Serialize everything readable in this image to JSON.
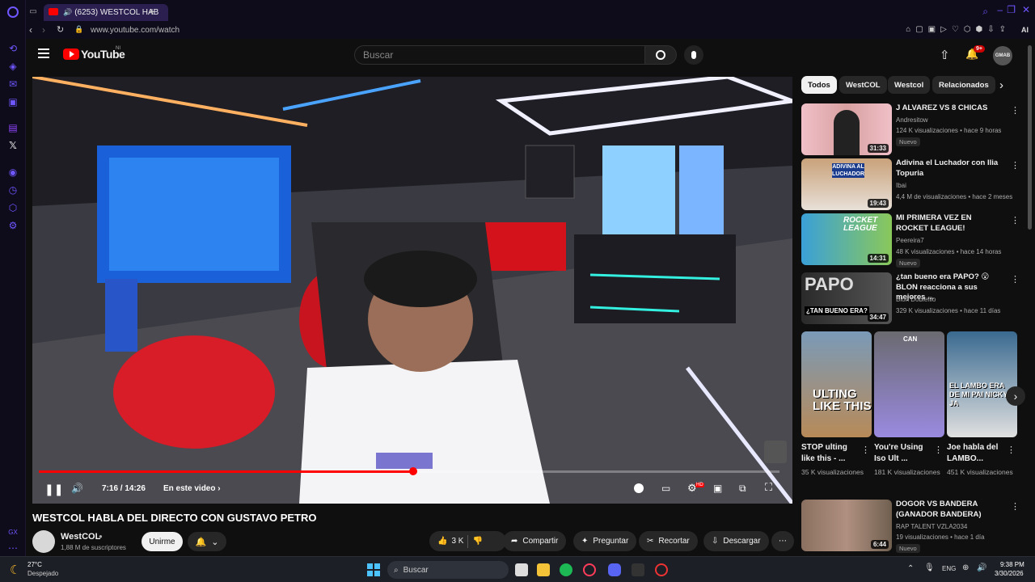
{
  "browser": {
    "tab_title": "(6253) WESTCOL HAB",
    "new_tab": "+",
    "url": "www.youtube.com/watch",
    "ai_label": "AI"
  },
  "youtube": {
    "logo_text": "YouTube",
    "logo_country": "NI",
    "search_placeholder": "Buscar",
    "notif_count": "9+",
    "avatar_text": "GMAB"
  },
  "player": {
    "time": "7:16 / 14:26",
    "chapter": "En este video",
    "chapter_arrow": "›",
    "progress": 0.505,
    "hd_badge": "HD"
  },
  "video": {
    "title": "WESTCOL HABLA DEL DIRECTO CON GUSTAVO PETRO",
    "channel": "WestCOL",
    "subscribers": "1,88 M de suscriptores",
    "join": "Unirme",
    "likes": "3 K",
    "share": "Compartir",
    "ask": "Preguntar",
    "clip": "Recortar",
    "download": "Descargar"
  },
  "chips": [
    "Todos",
    "WestCOL",
    "Westcol",
    "Relacionados"
  ],
  "related": [
    {
      "title": "J ALVAREZ VS 8 CHICAS",
      "channel": "Andresitow",
      "meta": "124 K visualizaciones • hace 9 horas",
      "duration": "31:33",
      "badge": "Nuevo"
    },
    {
      "title": "Adivina el Luchador con Ilia Topuria",
      "channel": "Ibai",
      "meta": "4,4 M de visualizaciones • hace 2 meses",
      "duration": "19:43",
      "badge": ""
    },
    {
      "title": "MI PRIMERA VEZ EN ROCKET LEAGUE!",
      "channel": "Peereira7",
      "meta": "48 K visualizaciones • hace 14 horas",
      "duration": "14:31",
      "badge": "Nuevo"
    },
    {
      "title": "¿tan bueno era PAPO? 😮 BLON reacciona a sus mejores ...",
      "channel": "Blon Doblefilo",
      "meta": "329 K visualizaciones • hace 11 días",
      "duration": "34:47",
      "badge": ""
    }
  ],
  "shorts": [
    {
      "title": "STOP ulting like this - ...",
      "views": "35 K visualizaciones",
      "overlay": "ULTING LIKE THIS"
    },
    {
      "title": "You're Using Iso Ult ...",
      "views": "181 K visualizaciones",
      "overlay": "CAN"
    },
    {
      "title": "Joe habla del LAMBO...",
      "views": "451 K visualizaciones",
      "overlay": "EL LAMBO ERA DE MI PAI NICKY JA"
    }
  ],
  "related_bottom": {
    "title": "DOGOR VS BANDERA (GANADOR BANDERA)",
    "channel": "RAP TALENT VZLA2034",
    "meta": "19 visualizaciones • hace 1 día",
    "duration": "6:44",
    "badge": "Nuevo"
  },
  "thumb_text": {
    "luchador": "ADIVINA AL LUCHADOR",
    "rocket": "ROCKET LEAGUE",
    "papo": "PAPO",
    "papo_sub": "¿TAN BUENO ERA?"
  },
  "taskbar": {
    "temp": "27°C",
    "weather": "Despejado",
    "search": "Buscar",
    "lang": "ENG",
    "time": "9:38 PM",
    "date": "3/30/2026"
  }
}
